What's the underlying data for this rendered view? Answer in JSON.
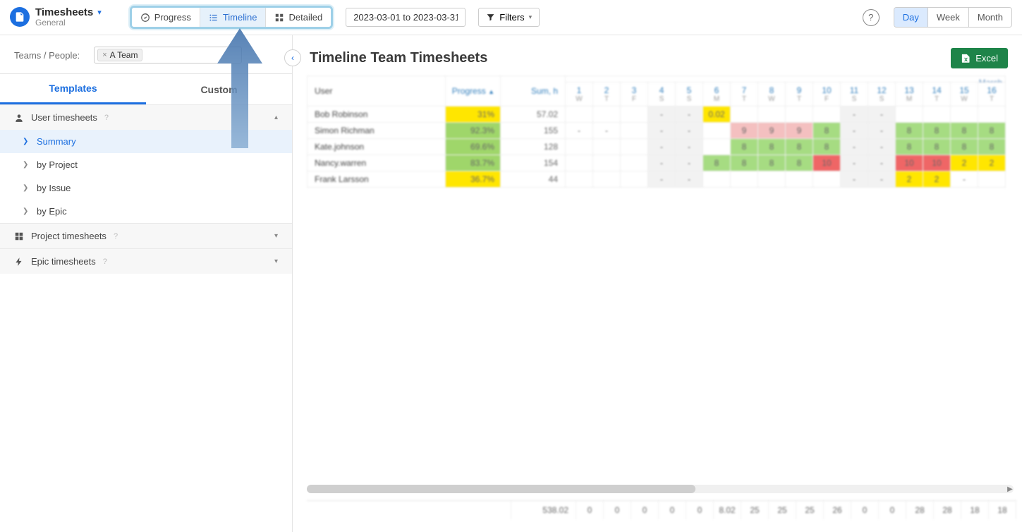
{
  "app": {
    "title": "Timesheets",
    "subtitle": "General"
  },
  "viewtabs": {
    "progress": "Progress",
    "timeline": "Timeline",
    "detailed": "Detailed"
  },
  "daterange": "2023-03-01 to 2023-03-31",
  "filters_label": "Filters",
  "period": {
    "day": "Day",
    "week": "Week",
    "month": "Month"
  },
  "sidebar": {
    "filter_label": "Teams / People:",
    "chip": "A Team",
    "tabs": {
      "templates": "Templates",
      "custom": "Custom"
    },
    "groups": {
      "user": {
        "label": "User timesheets"
      },
      "project": {
        "label": "Project timesheets"
      },
      "epic": {
        "label": "Epic timesheets"
      }
    },
    "items": {
      "summary": "Summary",
      "by_project": "by Project",
      "by_issue": "by Issue",
      "by_epic": "by Epic"
    }
  },
  "main": {
    "title": "Timeline Team Timesheets",
    "excel": "Excel"
  },
  "table": {
    "headers": {
      "user": "User",
      "progress": "Progress",
      "sum": "Sum, h",
      "month": "March"
    },
    "days": [
      {
        "n": "1",
        "d": "W"
      },
      {
        "n": "2",
        "d": "T"
      },
      {
        "n": "3",
        "d": "F"
      },
      {
        "n": "4",
        "d": "S"
      },
      {
        "n": "5",
        "d": "S"
      },
      {
        "n": "6",
        "d": "M"
      },
      {
        "n": "7",
        "d": "T"
      },
      {
        "n": "8",
        "d": "W"
      },
      {
        "n": "9",
        "d": "T"
      },
      {
        "n": "10",
        "d": "F"
      },
      {
        "n": "11",
        "d": "S"
      },
      {
        "n": "12",
        "d": "S"
      },
      {
        "n": "13",
        "d": "M"
      },
      {
        "n": "14",
        "d": "T"
      },
      {
        "n": "15",
        "d": "W"
      },
      {
        "n": "16",
        "d": "T"
      }
    ],
    "rows": [
      {
        "user": "Bob Robinson",
        "prog": "31%",
        "pg": "y",
        "sum": "57.02",
        "cells": [
          "",
          "",
          "",
          "-",
          "-",
          "0.02",
          "",
          "",
          "",
          "",
          "-",
          "-",
          "",
          "",
          "",
          ""
        ]
      },
      {
        "user": "Simon Richman",
        "prog": "92.3%",
        "pg": "g",
        "sum": "155",
        "cells": [
          "-",
          "-",
          "",
          "-",
          "-",
          "",
          "9",
          "9",
          "9",
          "8",
          "-",
          "-",
          "8",
          "8",
          "8",
          "8"
        ]
      },
      {
        "user": "Kate.johnson",
        "prog": "69.6%",
        "pg": "g",
        "sum": "128",
        "cells": [
          "",
          "",
          "",
          "-",
          "-",
          "",
          "8",
          "8",
          "8",
          "8",
          "-",
          "-",
          "8",
          "8",
          "8",
          "8"
        ]
      },
      {
        "user": "Nancy.warren",
        "prog": "83.7%",
        "pg": "g",
        "sum": "154",
        "cells": [
          "",
          "",
          "",
          "-",
          "-",
          "8",
          "8",
          "8",
          "8",
          "10",
          "-",
          "-",
          "10",
          "10",
          "2",
          "2"
        ]
      },
      {
        "user": "Frank Larsson",
        "prog": "36.7%",
        "pg": "y",
        "sum": "44",
        "cells": [
          "",
          "",
          "",
          "-",
          "-",
          "",
          "",
          "",
          "",
          "",
          "-",
          "-",
          "2",
          "2",
          "-",
          ""
        ]
      }
    ],
    "totals": [
      "538.02",
      "0",
      "0",
      "0",
      "0",
      "0",
      "8.02",
      "25",
      "25",
      "25",
      "26",
      "0",
      "0",
      "28",
      "28",
      "18",
      "18"
    ]
  }
}
